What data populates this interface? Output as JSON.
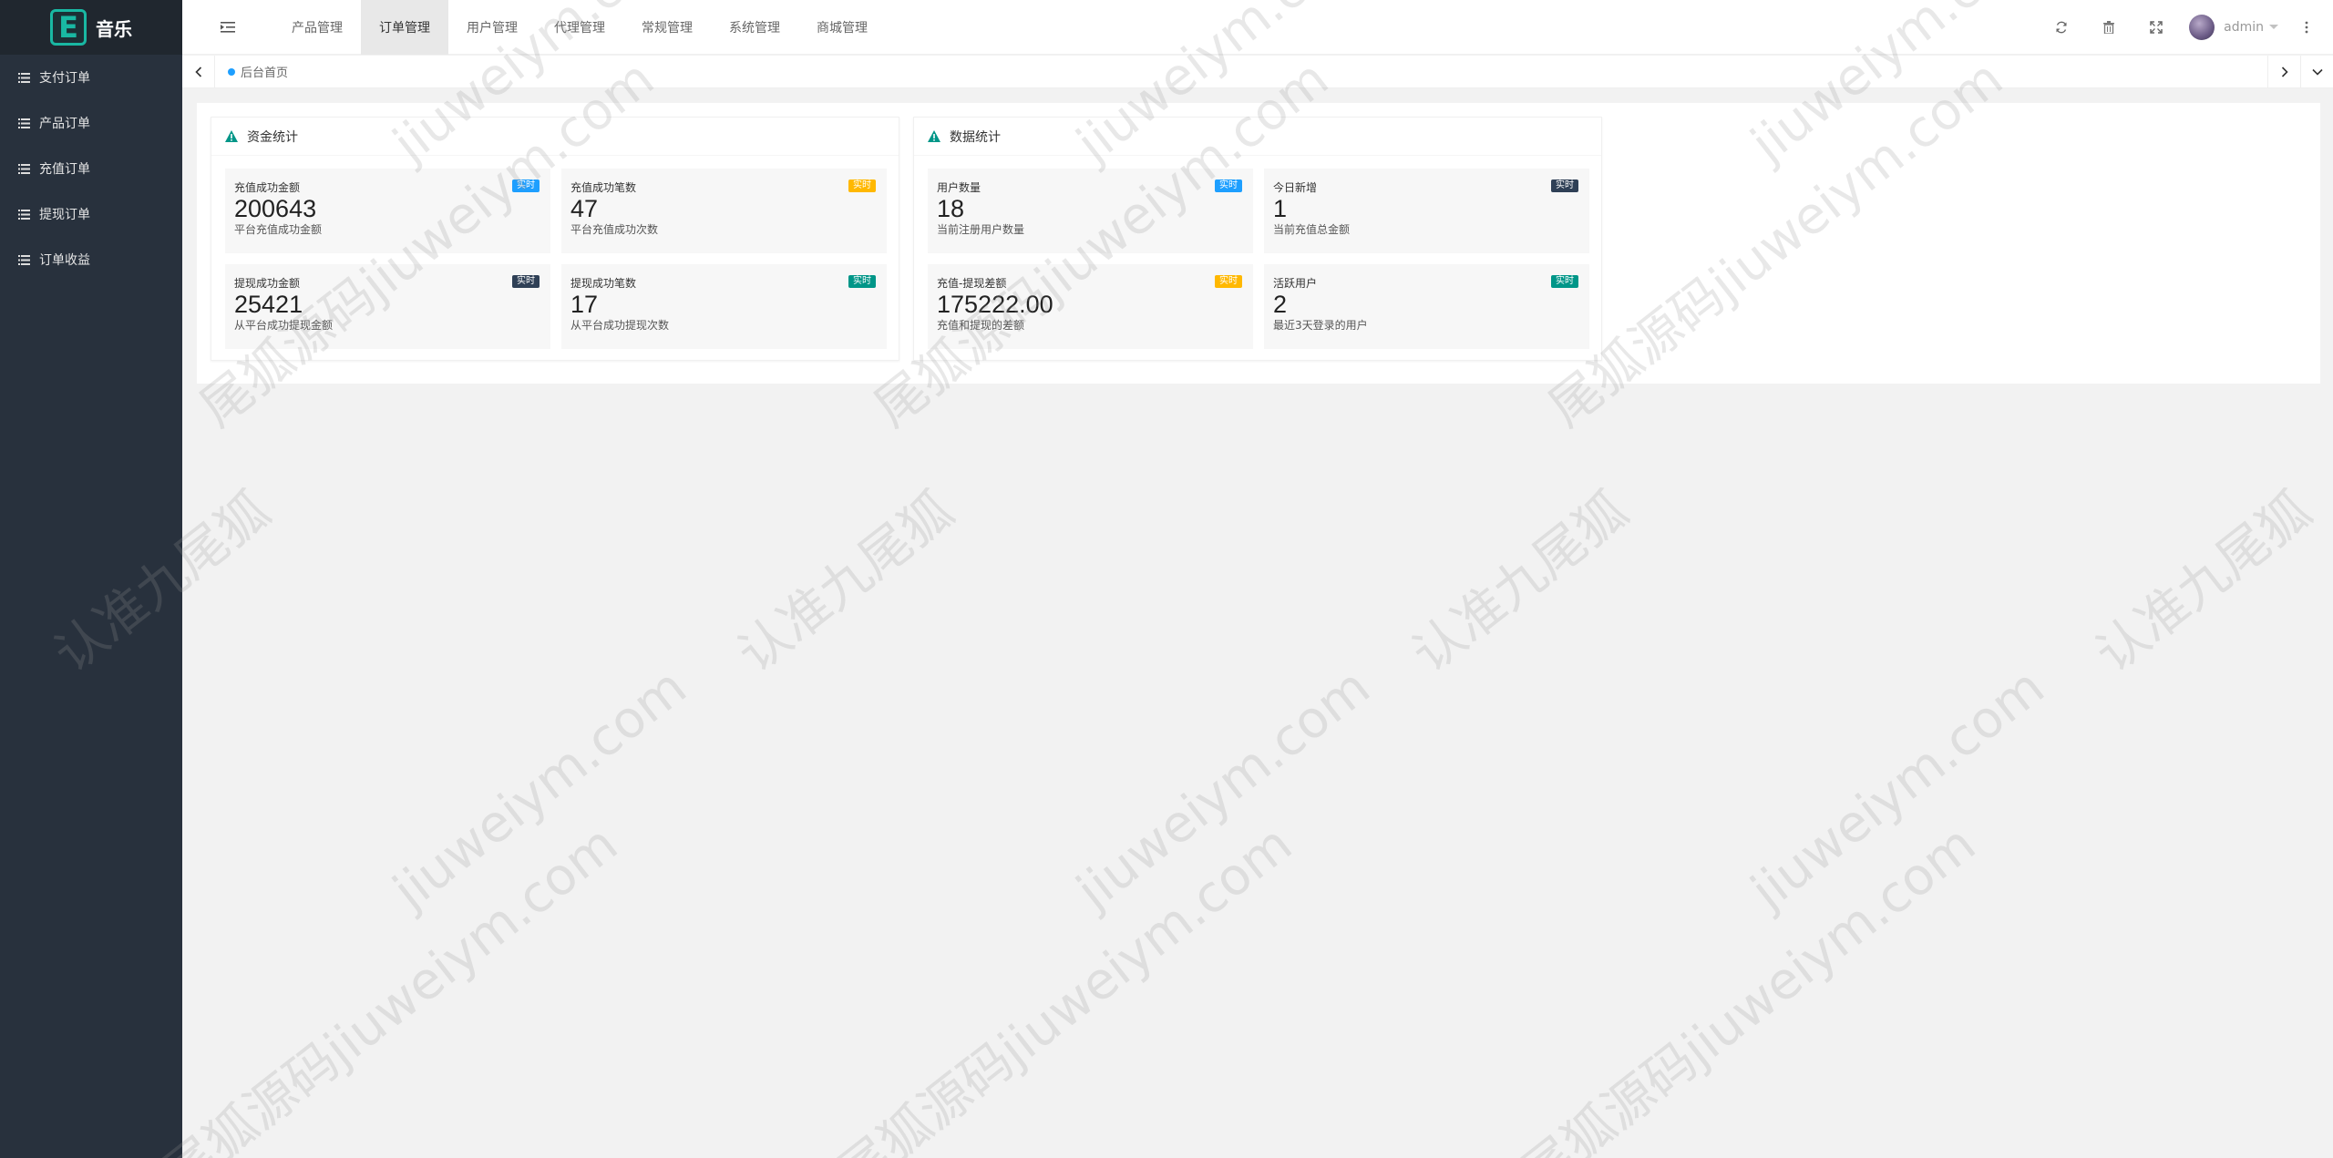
{
  "app": {
    "logo_letter": "E",
    "logo_text": "音乐",
    "accent": "#19b8a3"
  },
  "sidebar": {
    "items": [
      {
        "label": "支付订单",
        "icon": "list-icon"
      },
      {
        "label": "产品订单",
        "icon": "list-icon"
      },
      {
        "label": "充值订单",
        "icon": "list-icon"
      },
      {
        "label": "提现订单",
        "icon": "list-icon"
      },
      {
        "label": "订单收益",
        "icon": "list-icon"
      }
    ]
  },
  "header": {
    "nav": [
      {
        "label": "产品管理",
        "active": false
      },
      {
        "label": "订单管理",
        "active": true
      },
      {
        "label": "用户管理",
        "active": false
      },
      {
        "label": "代理管理",
        "active": false
      },
      {
        "label": "常规管理",
        "active": false
      },
      {
        "label": "系统管理",
        "active": false
      },
      {
        "label": "商城管理",
        "active": false
      }
    ],
    "icons": [
      "menu-toggle-icon",
      "refresh-icon",
      "trash-icon",
      "fullscreen-icon",
      "more-vertical-icon"
    ],
    "user": {
      "name": "admin"
    }
  },
  "tabs": {
    "items": [
      {
        "label": "后台首页"
      }
    ]
  },
  "panels": [
    {
      "title": "资金统计",
      "cards": [
        {
          "title": "充值成功金额",
          "value": "200643",
          "desc": "平台充值成功金额",
          "badge": "实时",
          "badge_color": "#1e9fff"
        },
        {
          "title": "充值成功笔数",
          "value": "47",
          "desc": "平台充值成功次数",
          "badge": "实时",
          "badge_color": "#ffb800"
        },
        {
          "title": "提现成功金额",
          "value": "25421",
          "desc": "从平台成功提现金额",
          "badge": "实时",
          "badge_color": "#2f4056"
        },
        {
          "title": "提现成功笔数",
          "value": "17",
          "desc": "从平台成功提现次数",
          "badge": "实时",
          "badge_color": "#009688"
        }
      ]
    },
    {
      "title": "数据统计",
      "cards": [
        {
          "title": "用户数量",
          "value": "18",
          "desc": "当前注册用户数量",
          "badge": "实时",
          "badge_color": "#1e9fff"
        },
        {
          "title": "今日新增",
          "value": "1",
          "desc": "当前充值总金额",
          "badge": "实时",
          "badge_color": "#2f4056"
        },
        {
          "title": "充值-提现差额",
          "value": "175222.00",
          "desc": "充值和提现的差额",
          "badge": "实时",
          "badge_color": "#ffb800"
        },
        {
          "title": "活跃用户",
          "value": "2",
          "desc": "最近3天登录的用户",
          "badge": "实时",
          "badge_color": "#009688"
        }
      ]
    }
  ],
  "watermark": {
    "site": "jiuweiym.com",
    "text_a": "认准九尾狐",
    "text_b": "尾狐源码jiuweiym.com"
  }
}
